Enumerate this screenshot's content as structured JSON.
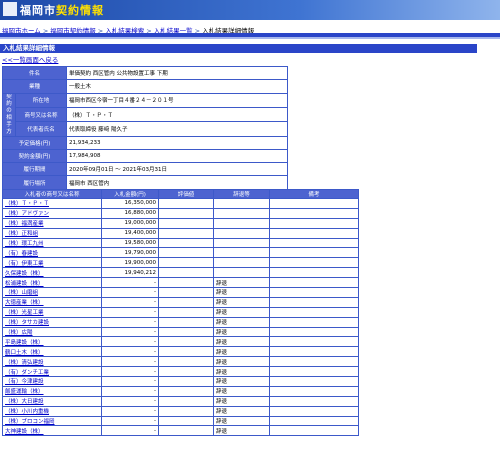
{
  "header": {
    "logo_text": "福岡市",
    "logo_highlight": "契約情報"
  },
  "breadcrumb": [
    "福岡市ホーム",
    "福岡市契約情報",
    "入札結果検索",
    "入札結果一覧",
    "入札結果詳細情報"
  ],
  "breadcrumb_sep": ">",
  "page_title": "入札結果詳細情報",
  "back_link": "<<一覧画面へ戻る",
  "details": {
    "project_label": "件名",
    "project_value": "単価契約 西区管内 公共物設置工事 下期",
    "category_label": "業種",
    "category_value": "一般土木",
    "group_label": "契約の相手方",
    "address_label": "所在地",
    "address_value": "福岡市西区今宿一丁目４番２４－２０１号",
    "company_label": "商号又は名称",
    "company_value": "（株）Ｔ・Ｐ・Ｔ",
    "rep_label": "代表者氏名",
    "rep_value": "代表取締役 藤﨑 陽久子",
    "estimate_label": "予定価格(円)",
    "estimate_value": "21,934,233",
    "contract_label": "契約金額(円)",
    "contract_value": "17,984,908",
    "period_label": "履行期間",
    "period_value": "2020年09月01日 ～ 2021年03月31日",
    "place_label": "履行場所",
    "place_value": "福岡市 西区管内"
  },
  "bid_table": {
    "headers": [
      "入札者の商号又は名称",
      "入札金額(円)",
      "評価値",
      "辞退等",
      "備考"
    ],
    "rows": [
      {
        "name": "（株）Ｔ・Ｐ・Ｔ",
        "amount": "16,350,000",
        "eval": "",
        "status": "",
        "note": ""
      },
      {
        "name": "（株）アドヴァン",
        "amount": "16,880,000",
        "eval": "",
        "status": "",
        "note": ""
      },
      {
        "name": "（株）福満産業",
        "amount": "19,000,000",
        "eval": "",
        "status": "",
        "note": ""
      },
      {
        "name": "（株）正和組",
        "amount": "19,400,000",
        "eval": "",
        "status": "",
        "note": ""
      },
      {
        "name": "（株）環工九州",
        "amount": "19,580,000",
        "eval": "",
        "status": "",
        "note": ""
      },
      {
        "name": "（有）春建設",
        "amount": "19,790,000",
        "eval": "",
        "status": "",
        "note": ""
      },
      {
        "name": "（有）伊東工業",
        "amount": "19,900,000",
        "eval": "",
        "status": "",
        "note": ""
      },
      {
        "name": "久保建設（株）",
        "amount": "19,940,212",
        "eval": "",
        "status": "",
        "note": ""
      },
      {
        "name": "松浦建設（株）",
        "amount": "-",
        "eval": "",
        "status": "辞退",
        "note": ""
      },
      {
        "name": "（株）山磨組",
        "amount": "-",
        "eval": "",
        "status": "辞退",
        "note": ""
      },
      {
        "name": "大徳産業（株）",
        "amount": "-",
        "eval": "",
        "status": "辞退",
        "note": ""
      },
      {
        "name": "（株）光星工業",
        "amount": "-",
        "eval": "",
        "status": "辞退",
        "note": ""
      },
      {
        "name": "（株）タサカ建設",
        "amount": "-",
        "eval": "",
        "status": "辞退",
        "note": ""
      },
      {
        "name": "（株）広陽",
        "amount": "-",
        "eval": "",
        "status": "辞退",
        "note": ""
      },
      {
        "name": "平島建設（株）",
        "amount": "-",
        "eval": "",
        "status": "辞退",
        "note": ""
      },
      {
        "name": "鶴口土木（株）",
        "amount": "-",
        "eval": "",
        "status": "辞退",
        "note": ""
      },
      {
        "name": "（株）清弘建設",
        "amount": "-",
        "eval": "",
        "status": "辞退",
        "note": ""
      },
      {
        "name": "（有）ダンチ工業",
        "amount": "-",
        "eval": "",
        "status": "辞退",
        "note": ""
      },
      {
        "name": "（有）今津建設",
        "amount": "-",
        "eval": "",
        "status": "辞退",
        "note": ""
      },
      {
        "name": "飯盛運輸（株）",
        "amount": "-",
        "eval": "",
        "status": "辞退",
        "note": ""
      },
      {
        "name": "（株）大日建設",
        "amount": "-",
        "eval": "",
        "status": "辞退",
        "note": ""
      },
      {
        "name": "（株）小川内重機",
        "amount": "-",
        "eval": "",
        "status": "辞退",
        "note": ""
      },
      {
        "name": "（株）ブロコン福岡",
        "amount": "-",
        "eval": "",
        "status": "辞退",
        "note": ""
      },
      {
        "name": "大神建設（株）",
        "amount": "-",
        "eval": "",
        "status": "辞退",
        "note": ""
      }
    ]
  }
}
